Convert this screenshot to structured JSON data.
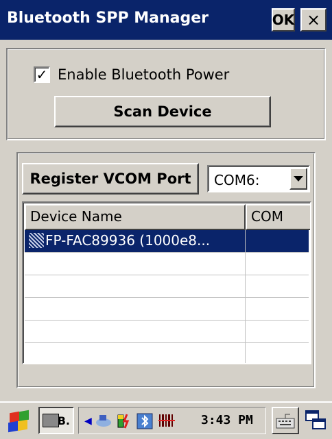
{
  "window": {
    "title": "Bluetooth SPP Manager",
    "ok_label": "OK",
    "close_label": "×"
  },
  "power": {
    "checkbox_checked": true,
    "checkbox_label": "Enable Bluetooth Power",
    "check_glyph": "✓"
  },
  "scan": {
    "button_label": "Scan Device"
  },
  "vcom": {
    "register_label": "Register VCOM Port",
    "selected_port": "COM6:"
  },
  "device_list": {
    "columns": [
      "Device Name",
      "COM"
    ],
    "rows": [
      {
        "name": "FP-FAC89936 (1000e8...",
        "com": "",
        "selected": true
      },
      {
        "name": "",
        "com": ""
      },
      {
        "name": "",
        "com": ""
      },
      {
        "name": "",
        "com": ""
      },
      {
        "name": "",
        "com": ""
      },
      {
        "name": "",
        "com": ""
      }
    ]
  },
  "taskbar": {
    "task_label": "B.",
    "clock": "3:43 PM",
    "icons": [
      "start-flag-icon",
      "printer-icon",
      "tray-arrow-icon",
      "network-icon",
      "battery-icon",
      "bluetooth-icon",
      "barcode-icon",
      "keyboard-icon",
      "window-switch-icon"
    ]
  },
  "colors": {
    "title_bar": "#0a246a",
    "face": "#d4d0c8",
    "selection": "#0a246a"
  }
}
